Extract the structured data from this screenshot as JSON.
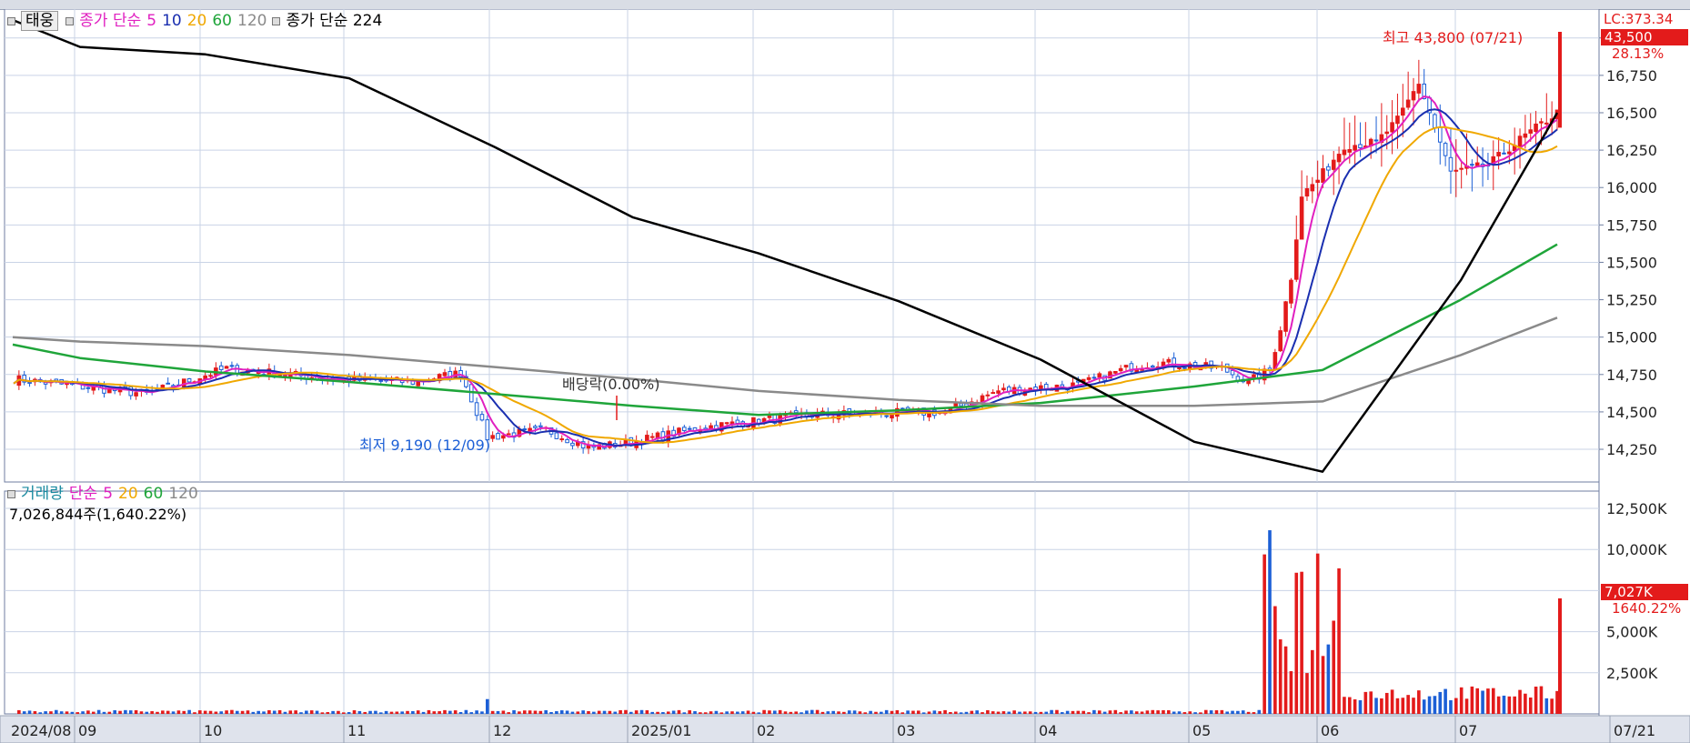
{
  "legend": {
    "stock_name": "태웅",
    "price_ma_title": "종가 단순",
    "price_ma_periods": [
      "5",
      "10",
      "20",
      "60",
      "120"
    ],
    "ma224_label": "종가 단순 224",
    "volume_title": "거래량",
    "volume_ma_title": "단순",
    "volume_ma_periods": [
      "5",
      "20",
      "60",
      "120"
    ]
  },
  "volume_info": "7,026,844주(1,640.22%)",
  "colors": {
    "up": "#e31b1b",
    "down": "#1c5fd6",
    "ma5": "#e020c0",
    "ma10": "#1a2fb0",
    "ma20": "#f0a800",
    "ma60": "#1fa53a",
    "ma120": "#8a8a8a",
    "ma224": "#000000",
    "grid": "#c9d3e6"
  },
  "chart_data": [
    {
      "type": "candlestick",
      "title": "",
      "x_tick_labels": [
        "2024/08",
        "09",
        "10",
        "11",
        "12",
        "2025/01",
        "02",
        "03",
        "04",
        "05",
        "06",
        "07",
        "07/21"
      ],
      "y_tick_labels": [
        "14,250",
        "14,500",
        "14,750",
        "15,000",
        "15,250",
        "15,500",
        "15,750",
        "16,000",
        "16,250",
        "16,500",
        "16,750",
        "17,000"
      ],
      "ylim": [
        14080,
        17120
      ],
      "grid": true,
      "last_price_box": "43,500",
      "last_change_pct": "28.13%",
      "lc_label": "LC:373.34",
      "annotations": {
        "high": "최고 43,800 (07/21)",
        "low": "최저 9,190 (12/09)",
        "dividend": "배당락(0.00%)"
      },
      "series": [
        {
          "name": "5",
          "ref": "종가 단순 5"
        },
        {
          "name": "10",
          "ref": "종가 단순 10"
        },
        {
          "name": "20",
          "ref": "종가 단순 20"
        },
        {
          "name": "60",
          "ref": "종가 단순 60",
          "x": [
            "2024/08",
            "09",
            "10",
            "11",
            "12",
            "2025/01",
            "02",
            "03",
            "04",
            "05",
            "06",
            "07",
            "07/21"
          ],
          "values": [
            14950,
            14860,
            14770,
            14700,
            14620,
            14540,
            14480,
            14510,
            14560,
            14670,
            14780,
            15250,
            15620
          ]
        },
        {
          "name": "120",
          "ref": "종가 단순 120",
          "x": [
            "2024/08",
            "09",
            "10",
            "11",
            "12",
            "2025/01",
            "02",
            "03",
            "04",
            "05",
            "06",
            "07",
            "07/21"
          ],
          "values": [
            15000,
            14970,
            14940,
            14880,
            14800,
            14720,
            14640,
            14580,
            14540,
            14540,
            14570,
            14880,
            15130
          ]
        },
        {
          "name": "224",
          "ref": "종가 단순 224",
          "x": [
            "2024/08",
            "09",
            "10",
            "11",
            "12",
            "2025/01",
            "02",
            "03",
            "04",
            "05",
            "06",
            "07",
            "07/21"
          ],
          "values": [
            17120,
            16940,
            16890,
            16730,
            16270,
            15800,
            15560,
            15240,
            14850,
            14300,
            14100,
            15380,
            16500
          ]
        }
      ]
    },
    {
      "type": "bar",
      "title": "거래량",
      "y_tick_labels": [
        "2,500K",
        "5,000K",
        "7,500K",
        "10,000K",
        "12,500K"
      ],
      "ylim": [
        0,
        13000000
      ],
      "last_value_box": "7,027K",
      "last_change_pct": "1640.22%",
      "x": [
        "2024/08",
        "09",
        "10",
        "11",
        "12",
        "2025/01",
        "02",
        "03",
        "04",
        "05",
        "06",
        "07",
        "07/21"
      ],
      "values": [
        150000,
        120000,
        100000,
        900000,
        130000,
        400000,
        250000,
        200000,
        180000,
        150000,
        12200000,
        1300000,
        7027000
      ]
    }
  ]
}
